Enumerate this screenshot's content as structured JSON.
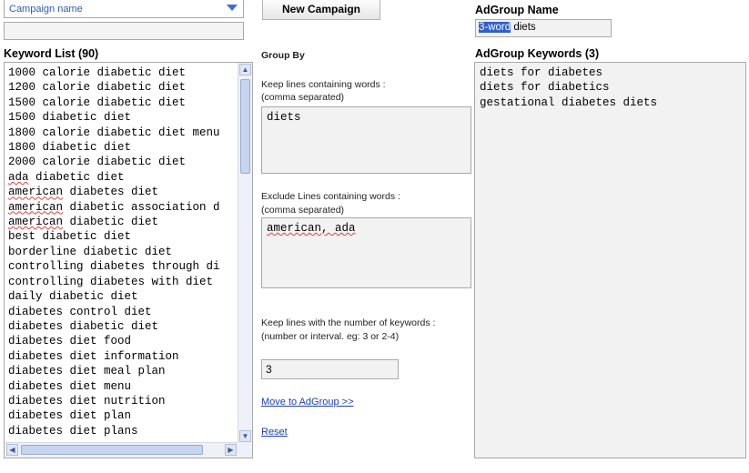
{
  "campaign": {
    "select_label": "Campaign name",
    "name_value": ""
  },
  "buttons": {
    "new_campaign": "New Campaign"
  },
  "keyword_list": {
    "title": "Keyword List (90)",
    "items": [
      {
        "text": "1000 calorie diabetic diet",
        "underline": false
      },
      {
        "text": "1200 calorie diabetic diet",
        "underline": false
      },
      {
        "text": "1500 calorie diabetic diet",
        "underline": false
      },
      {
        "text": "1500 diabetic diet",
        "underline": false
      },
      {
        "text": "1800 calorie diabetic diet menu",
        "underline": false
      },
      {
        "text": "1800 diabetic diet",
        "underline": false
      },
      {
        "text": "2000 calorie diabetic diet",
        "underline": false
      },
      {
        "text": "ada diabetic diet",
        "underline": true
      },
      {
        "text": "american diabetes diet",
        "underline": true
      },
      {
        "text": "american diabetic association d",
        "underline": true
      },
      {
        "text": "american diabetic diet",
        "underline": true
      },
      {
        "text": "best diabetic diet",
        "underline": false
      },
      {
        "text": "borderline diabetic diet",
        "underline": false
      },
      {
        "text": "controlling diabetes through di",
        "underline": false
      },
      {
        "text": "controlling diabetes with diet",
        "underline": false
      },
      {
        "text": "daily diabetic diet",
        "underline": false
      },
      {
        "text": "diabetes control diet",
        "underline": false
      },
      {
        "text": "diabetes diabetic diet",
        "underline": false
      },
      {
        "text": "diabetes diet food",
        "underline": false
      },
      {
        "text": "diabetes diet information",
        "underline": false
      },
      {
        "text": "diabetes diet meal plan",
        "underline": false
      },
      {
        "text": "diabetes diet menu",
        "underline": false
      },
      {
        "text": "diabetes diet nutrition",
        "underline": false
      },
      {
        "text": "diabetes diet plan",
        "underline": false
      },
      {
        "text": "diabetes diet plans",
        "underline": false
      }
    ]
  },
  "group_by": {
    "title": "Group By",
    "keep_label_1": "Keep lines containing words :",
    "keep_label_2": "(comma separated)",
    "keep_value": "diets",
    "exclude_label_1": "Exclude Lines containing words :",
    "exclude_label_2": "(comma separated)",
    "exclude_value": "american, ada",
    "count_label_1": "Keep lines with the number of keywords :",
    "count_label_2": "(number or interval. eg: 3 or 2-4)",
    "count_value": "3",
    "move_link": "Move to AdGroup >>",
    "reset_link": "Reset"
  },
  "adgroup": {
    "name_title": "AdGroup Name",
    "name_selected": "3-word",
    "name_rest": " diets",
    "keywords_title": "AdGroup Keywords (3)",
    "keywords": [
      "diets for diabetes",
      "diets for diabetics",
      "gestational diabetes diets"
    ]
  }
}
